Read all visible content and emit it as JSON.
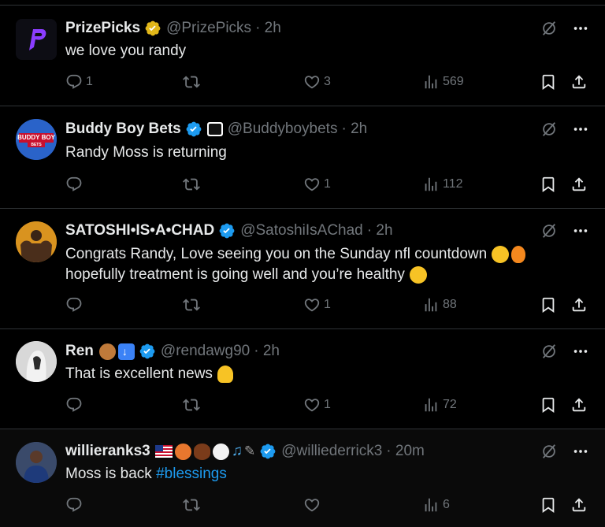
{
  "tweets": [
    {
      "display_name": "PrizePicks",
      "handle": "@PrizePicks",
      "time": "· 2h",
      "text": "we love you randy",
      "replies": "1",
      "retweets": "",
      "likes": "3",
      "views": "569",
      "verified": "gold",
      "avatar_color": "#0d0d14"
    },
    {
      "display_name": "Buddy Boy Bets",
      "handle": "@Buddyboybets",
      "time": "· 2h",
      "text": "Randy Moss is returning",
      "replies": "",
      "retweets": "",
      "likes": "1",
      "views": "112",
      "verified": "blue",
      "avatar_label": "BUDDY BOY",
      "avatar_sub": "BETS",
      "avatar_color": "#2a63c9"
    },
    {
      "display_name": "SATOSHI•IS•A•CHAD",
      "handle": "@SatoshiIsAChad",
      "time": "· 2h",
      "text_line1": "Congrats Randy, Love seeing you on the Sunday nfl countdown",
      "text_line2": "hopefully treatment is going well and you’re healthy",
      "replies": "",
      "retweets": "",
      "likes": "1",
      "views": "88",
      "verified": "blue",
      "avatar_color": "#d9931f"
    },
    {
      "display_name": "Ren",
      "handle": "@rendawg90",
      "time": "· 2h",
      "text": "That is excellent news",
      "replies": "",
      "retweets": "",
      "likes": "1",
      "views": "72",
      "verified": "blue",
      "avatar_color": "#d8d8d8"
    },
    {
      "display_name": "willieranks3",
      "handle": "@williederrick3",
      "time": "· 20m",
      "text": "Moss is back",
      "hashtag": "#blessings",
      "replies": "",
      "retweets": "",
      "likes": "",
      "views": "6",
      "verified": "blue",
      "avatar_color": "#3a4a6a"
    }
  ],
  "colors": {
    "background": "#000000",
    "text": "#e7e9ea",
    "muted": "#71767b",
    "divider": "#2f3336",
    "verified_blue": "#1d9bf0",
    "verified_gold": "#e2b719",
    "hashtag": "#1d9bf0"
  },
  "icons": [
    "reply-icon",
    "retweet-icon",
    "like-icon",
    "views-icon",
    "bookmark-icon",
    "share-icon",
    "grok-icon",
    "more-icon",
    "verified-badge-icon"
  ]
}
